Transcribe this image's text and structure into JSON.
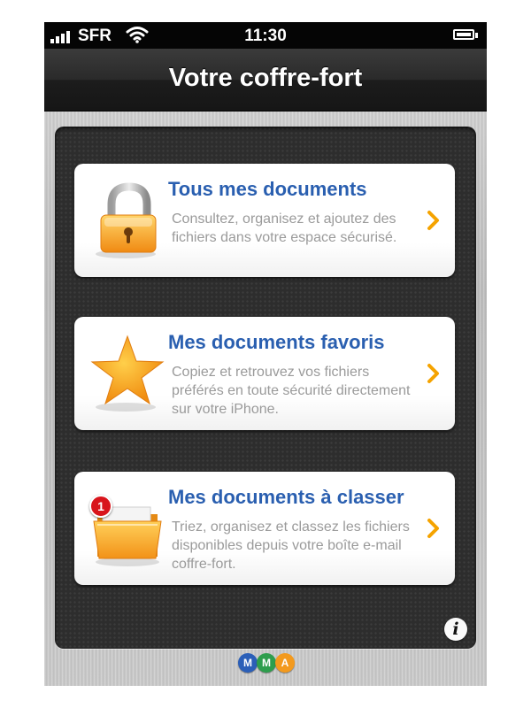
{
  "status_bar": {
    "carrier": "SFR",
    "time": "11:30",
    "icons": [
      "signal-icon",
      "wifi-icon",
      "battery-icon"
    ]
  },
  "nav": {
    "title": "Votre coffre-fort"
  },
  "cards": [
    {
      "title": "Tous mes documents",
      "description": "Consultez, organisez et ajoutez des fichiers dans votre espace sécurisé.",
      "icon": "padlock-icon"
    },
    {
      "title": "Mes documents favoris",
      "description": "Copiez et retrouvez vos fichiers préférés en toute sécurité directement sur votre iPhone.",
      "icon": "star-icon"
    },
    {
      "title": "Mes documents à classer",
      "description": "Triez, organisez et classez les fichiers disponibles depuis votre boîte e-mail coffre-fort.",
      "icon": "folder-icon",
      "badge": "1"
    }
  ],
  "info_button": {
    "label": "i",
    "icon": "info-icon"
  },
  "footer_logo": {
    "letters": [
      "M",
      "M",
      "A"
    ],
    "colors": [
      "#2b5fb8",
      "#2e9e4d",
      "#f39a1e"
    ]
  },
  "colors": {
    "title_blue": "#2a5fb0",
    "chevron_orange": "#f5a300",
    "badge_red": "#d8141b",
    "panel": "#2d2d2d"
  }
}
